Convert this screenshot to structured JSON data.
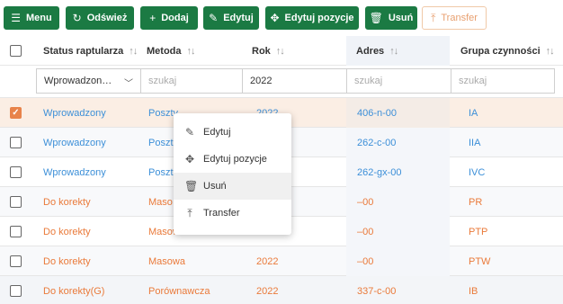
{
  "toolbar": {
    "menu": {
      "label": "Menu",
      "icon": "hamburger-icon"
    },
    "refresh": {
      "label": "Odśwież",
      "icon": "refresh-icon"
    },
    "add": {
      "label": "Dodaj",
      "icon": "plus-icon"
    },
    "edit": {
      "label": "Edytuj",
      "icon": "pencil-icon"
    },
    "edit_items": {
      "label": "Edytuj pozycje",
      "icon": "grid-edit-icon"
    },
    "delete": {
      "label": "Usuń",
      "icon": "trash-icon"
    },
    "transfer": {
      "label": "Transfer",
      "icon": "upload-icon"
    }
  },
  "table": {
    "headers": {
      "status": "Status raptularza",
      "metoda": "Metoda",
      "rok": "Rok",
      "adres": "Adres",
      "grupa": "Grupa czynności"
    },
    "filters": {
      "status_value": "Wprowadzon…",
      "metoda_placeholder": "szukaj",
      "rok_value": "2022",
      "adres_placeholder": "szukaj",
      "grupa_placeholder": "szukaj"
    },
    "rows": [
      {
        "status": "Wprowadzony",
        "metoda": "Poszty",
        "rok": "2022",
        "adres": "406-n-00",
        "grupa": "IA",
        "checked": true
      },
      {
        "status": "Wprowadzony",
        "metoda": "Poszt",
        "rok": "",
        "adres": "262-c-00",
        "grupa": "IIA",
        "checked": false
      },
      {
        "status": "Wprowadzony",
        "metoda": "Poszt",
        "rok": "",
        "adres": "262-gx-00",
        "grupa": "IVC",
        "checked": false
      },
      {
        "status": "Do korekty",
        "metoda": "Maso",
        "rok": "",
        "adres": "–00",
        "grupa": "PR",
        "checked": false
      },
      {
        "status": "Do korekty",
        "metoda": "Masowa",
        "rok": "",
        "adres": "–00",
        "grupa": "PTP",
        "checked": false
      },
      {
        "status": "Do korekty",
        "metoda": "Masowa",
        "rok": "2022",
        "adres": "–00",
        "grupa": "PTW",
        "checked": false
      },
      {
        "status": "Do korekty(G)",
        "metoda": "Porównawcza",
        "rok": "2022",
        "adres": "337-c-00",
        "grupa": "IB",
        "checked": false
      }
    ]
  },
  "context_menu": {
    "items": [
      {
        "label": "Edytuj",
        "icon": "pencil-icon"
      },
      {
        "label": "Edytuj pozycje",
        "icon": "grid-edit-icon"
      },
      {
        "label": "Usuń",
        "icon": "trash-icon"
      },
      {
        "label": "Transfer",
        "icon": "upload-icon"
      }
    ]
  },
  "colors": {
    "primary": "#1b7a43",
    "accent": "#e8834a",
    "link_blue": "#3c8fd8",
    "link_orange": "#ea7a3a"
  }
}
